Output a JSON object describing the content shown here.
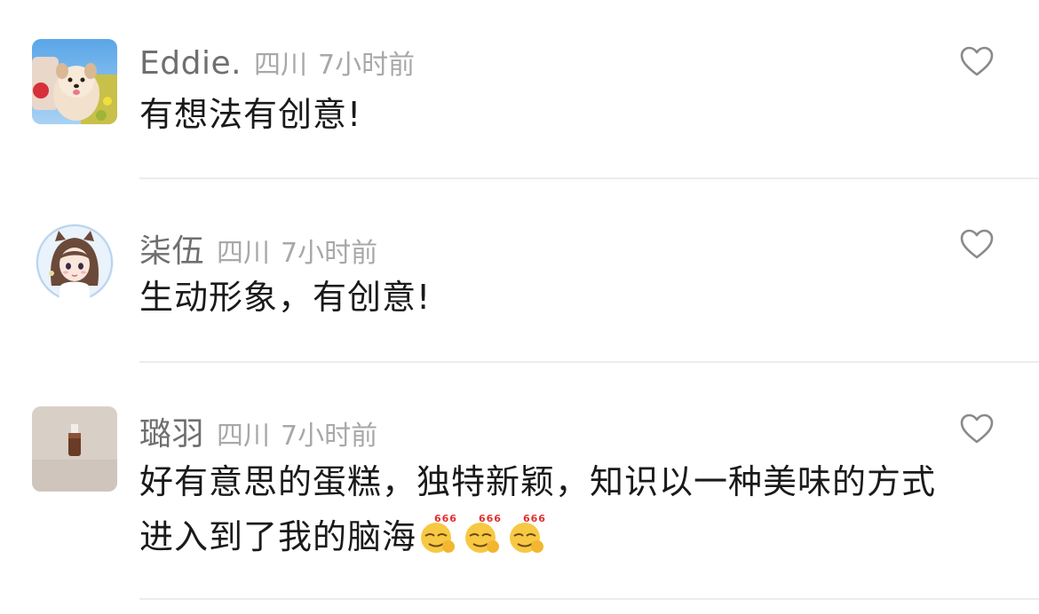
{
  "comments": [
    {
      "username": "Eddie.",
      "location": "四川",
      "time": "7小时前",
      "text": "有想法有创意!",
      "avatar": "puppy-photo",
      "like_icon": "heart-outline-icon"
    },
    {
      "username": "柒伍",
      "location": "四川",
      "time": "7小时前",
      "text": "生动形象，有创意!",
      "avatar": "anime-girl-illustration",
      "like_icon": "heart-outline-icon"
    },
    {
      "username": "璐羽",
      "location": "四川",
      "time": "7小时前",
      "text": "好有意思的蛋糕，独特新颖，知识以一种美味的方式进入到了我的脑海",
      "emoji_label": "666",
      "avatar": "bottle-photo",
      "like_icon": "heart-outline-icon"
    }
  ],
  "colors": {
    "username": "#6f6f6f",
    "meta": "#a8a8a8",
    "text": "#1a1a1a",
    "divider": "#ececec"
  }
}
